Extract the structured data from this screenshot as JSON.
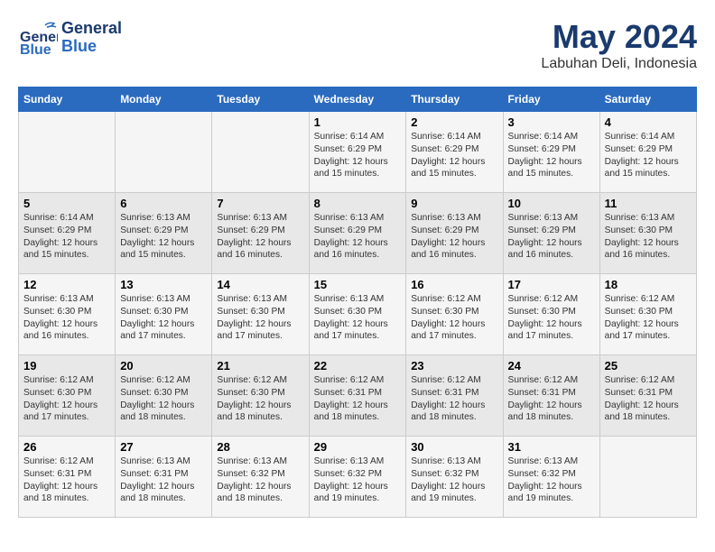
{
  "header": {
    "logo_general": "General",
    "logo_blue": "Blue",
    "month_year": "May 2024",
    "location": "Labuhan Deli, Indonesia"
  },
  "weekdays": [
    "Sunday",
    "Monday",
    "Tuesday",
    "Wednesday",
    "Thursday",
    "Friday",
    "Saturday"
  ],
  "weeks": [
    [
      {
        "day": "",
        "info": ""
      },
      {
        "day": "",
        "info": ""
      },
      {
        "day": "",
        "info": ""
      },
      {
        "day": "1",
        "info": "Sunrise: 6:14 AM\nSunset: 6:29 PM\nDaylight: 12 hours\nand 15 minutes."
      },
      {
        "day": "2",
        "info": "Sunrise: 6:14 AM\nSunset: 6:29 PM\nDaylight: 12 hours\nand 15 minutes."
      },
      {
        "day": "3",
        "info": "Sunrise: 6:14 AM\nSunset: 6:29 PM\nDaylight: 12 hours\nand 15 minutes."
      },
      {
        "day": "4",
        "info": "Sunrise: 6:14 AM\nSunset: 6:29 PM\nDaylight: 12 hours\nand 15 minutes."
      }
    ],
    [
      {
        "day": "5",
        "info": "Sunrise: 6:14 AM\nSunset: 6:29 PM\nDaylight: 12 hours\nand 15 minutes."
      },
      {
        "day": "6",
        "info": "Sunrise: 6:13 AM\nSunset: 6:29 PM\nDaylight: 12 hours\nand 15 minutes."
      },
      {
        "day": "7",
        "info": "Sunrise: 6:13 AM\nSunset: 6:29 PM\nDaylight: 12 hours\nand 16 minutes."
      },
      {
        "day": "8",
        "info": "Sunrise: 6:13 AM\nSunset: 6:29 PM\nDaylight: 12 hours\nand 16 minutes."
      },
      {
        "day": "9",
        "info": "Sunrise: 6:13 AM\nSunset: 6:29 PM\nDaylight: 12 hours\nand 16 minutes."
      },
      {
        "day": "10",
        "info": "Sunrise: 6:13 AM\nSunset: 6:29 PM\nDaylight: 12 hours\nand 16 minutes."
      },
      {
        "day": "11",
        "info": "Sunrise: 6:13 AM\nSunset: 6:30 PM\nDaylight: 12 hours\nand 16 minutes."
      }
    ],
    [
      {
        "day": "12",
        "info": "Sunrise: 6:13 AM\nSunset: 6:30 PM\nDaylight: 12 hours\nand 16 minutes."
      },
      {
        "day": "13",
        "info": "Sunrise: 6:13 AM\nSunset: 6:30 PM\nDaylight: 12 hours\nand 17 minutes."
      },
      {
        "day": "14",
        "info": "Sunrise: 6:13 AM\nSunset: 6:30 PM\nDaylight: 12 hours\nand 17 minutes."
      },
      {
        "day": "15",
        "info": "Sunrise: 6:13 AM\nSunset: 6:30 PM\nDaylight: 12 hours\nand 17 minutes."
      },
      {
        "day": "16",
        "info": "Sunrise: 6:12 AM\nSunset: 6:30 PM\nDaylight: 12 hours\nand 17 minutes."
      },
      {
        "day": "17",
        "info": "Sunrise: 6:12 AM\nSunset: 6:30 PM\nDaylight: 12 hours\nand 17 minutes."
      },
      {
        "day": "18",
        "info": "Sunrise: 6:12 AM\nSunset: 6:30 PM\nDaylight: 12 hours\nand 17 minutes."
      }
    ],
    [
      {
        "day": "19",
        "info": "Sunrise: 6:12 AM\nSunset: 6:30 PM\nDaylight: 12 hours\nand 17 minutes."
      },
      {
        "day": "20",
        "info": "Sunrise: 6:12 AM\nSunset: 6:30 PM\nDaylight: 12 hours\nand 18 minutes."
      },
      {
        "day": "21",
        "info": "Sunrise: 6:12 AM\nSunset: 6:30 PM\nDaylight: 12 hours\nand 18 minutes."
      },
      {
        "day": "22",
        "info": "Sunrise: 6:12 AM\nSunset: 6:31 PM\nDaylight: 12 hours\nand 18 minutes."
      },
      {
        "day": "23",
        "info": "Sunrise: 6:12 AM\nSunset: 6:31 PM\nDaylight: 12 hours\nand 18 minutes."
      },
      {
        "day": "24",
        "info": "Sunrise: 6:12 AM\nSunset: 6:31 PM\nDaylight: 12 hours\nand 18 minutes."
      },
      {
        "day": "25",
        "info": "Sunrise: 6:12 AM\nSunset: 6:31 PM\nDaylight: 12 hours\nand 18 minutes."
      }
    ],
    [
      {
        "day": "26",
        "info": "Sunrise: 6:12 AM\nSunset: 6:31 PM\nDaylight: 12 hours\nand 18 minutes."
      },
      {
        "day": "27",
        "info": "Sunrise: 6:13 AM\nSunset: 6:31 PM\nDaylight: 12 hours\nand 18 minutes."
      },
      {
        "day": "28",
        "info": "Sunrise: 6:13 AM\nSunset: 6:32 PM\nDaylight: 12 hours\nand 18 minutes."
      },
      {
        "day": "29",
        "info": "Sunrise: 6:13 AM\nSunset: 6:32 PM\nDaylight: 12 hours\nand 19 minutes."
      },
      {
        "day": "30",
        "info": "Sunrise: 6:13 AM\nSunset: 6:32 PM\nDaylight: 12 hours\nand 19 minutes."
      },
      {
        "day": "31",
        "info": "Sunrise: 6:13 AM\nSunset: 6:32 PM\nDaylight: 12 hours\nand 19 minutes."
      },
      {
        "day": "",
        "info": ""
      }
    ]
  ]
}
